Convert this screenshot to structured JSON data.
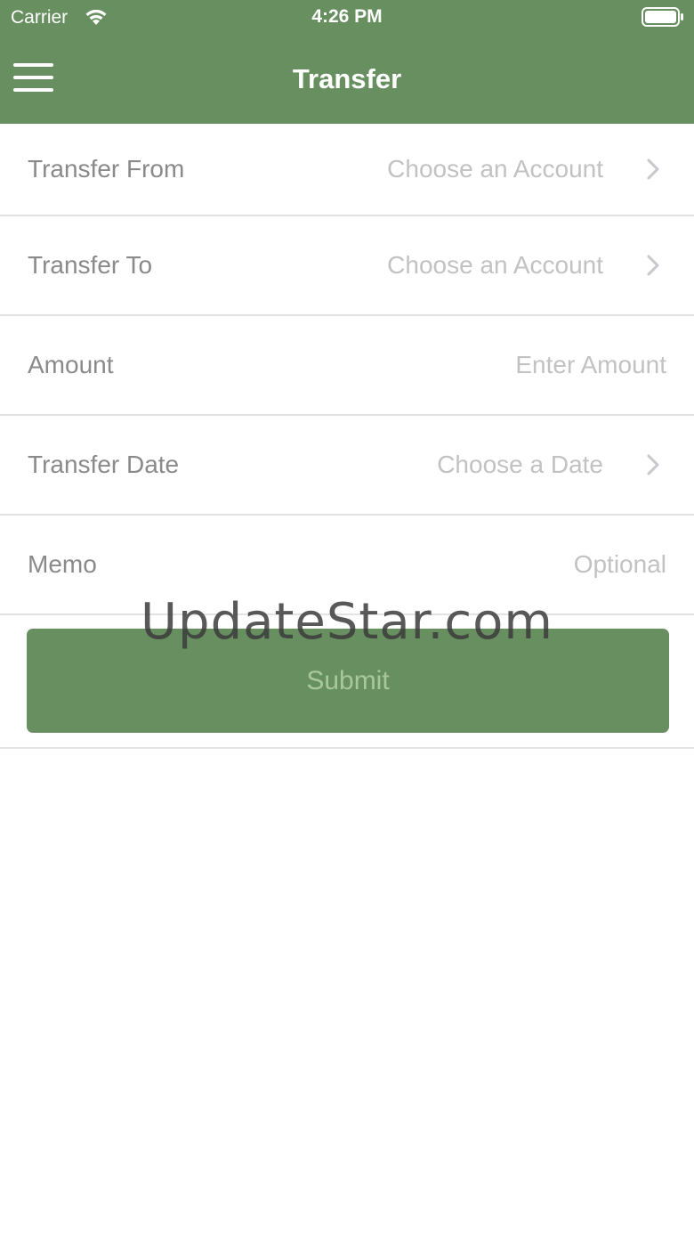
{
  "status_bar": {
    "carrier": "Carrier",
    "time": "4:26 PM",
    "wifi_icon": "wifi-icon",
    "battery_icon": "battery-icon"
  },
  "nav": {
    "title": "Transfer",
    "menu_icon": "hamburger-menu-icon"
  },
  "form": {
    "transfer_from": {
      "label": "Transfer From",
      "value": "Choose an Account"
    },
    "transfer_to": {
      "label": "Transfer To",
      "value": "Choose an Account"
    },
    "amount": {
      "label": "Amount",
      "placeholder": "Enter Amount"
    },
    "transfer_date": {
      "label": "Transfer Date",
      "value": "Choose a Date"
    },
    "memo": {
      "label": "Memo",
      "placeholder": "Optional"
    }
  },
  "submit": {
    "label": "Submit"
  },
  "watermark": {
    "text": "UpdateStar.com"
  },
  "colors": {
    "brand": "#678f5f",
    "submit_text": "#a9c79d",
    "label_text": "#8a8a8a",
    "placeholder_text": "#c2c2c2",
    "divider": "#e3e3e3"
  }
}
